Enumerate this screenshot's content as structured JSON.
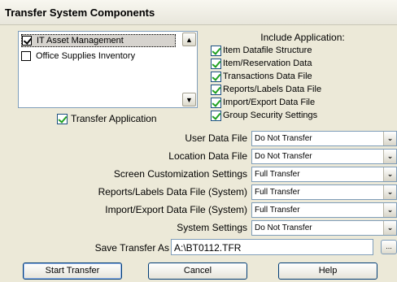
{
  "window": {
    "title": "Transfer System Components"
  },
  "applications": [
    {
      "label": "IT Asset Management",
      "checked": true,
      "selected": true
    },
    {
      "label": "Office Supplies Inventory",
      "checked": false,
      "selected": false
    }
  ],
  "transfer_application": {
    "label": "Transfer Application",
    "checked": true
  },
  "include": {
    "title": "Include Application:",
    "items": [
      {
        "label": "Item Datafile Structure",
        "checked": true
      },
      {
        "label": "Item/Reservation Data",
        "checked": true
      },
      {
        "label": "Transactions Data File",
        "checked": true
      },
      {
        "label": "Reports/Labels Data File",
        "checked": true
      },
      {
        "label": "Import/Export Data File",
        "checked": true
      },
      {
        "label": "Group Security Settings",
        "checked": true
      }
    ]
  },
  "settings": [
    {
      "label": "User Data File",
      "value": "Do Not Transfer"
    },
    {
      "label": "Location Data File",
      "value": "Do Not Transfer"
    },
    {
      "label": "Screen Customization Settings",
      "value": "Full Transfer"
    },
    {
      "label": "Reports/Labels Data File (System)",
      "value": "Full Transfer"
    },
    {
      "label": "Import/Export Data File (System)",
      "value": "Full Transfer"
    },
    {
      "label": "System Settings",
      "value": "Do Not Transfer"
    }
  ],
  "save": {
    "label": "Save Transfer As",
    "value": "A:\\BT0112.TFR",
    "browse_label": "..."
  },
  "buttons": {
    "start": "Start Transfer",
    "cancel": "Cancel",
    "help": "Help"
  },
  "colors": {
    "dialog_bg": "#ece9d8",
    "check_green": "#21a121",
    "input_border": "#7f9db9"
  }
}
